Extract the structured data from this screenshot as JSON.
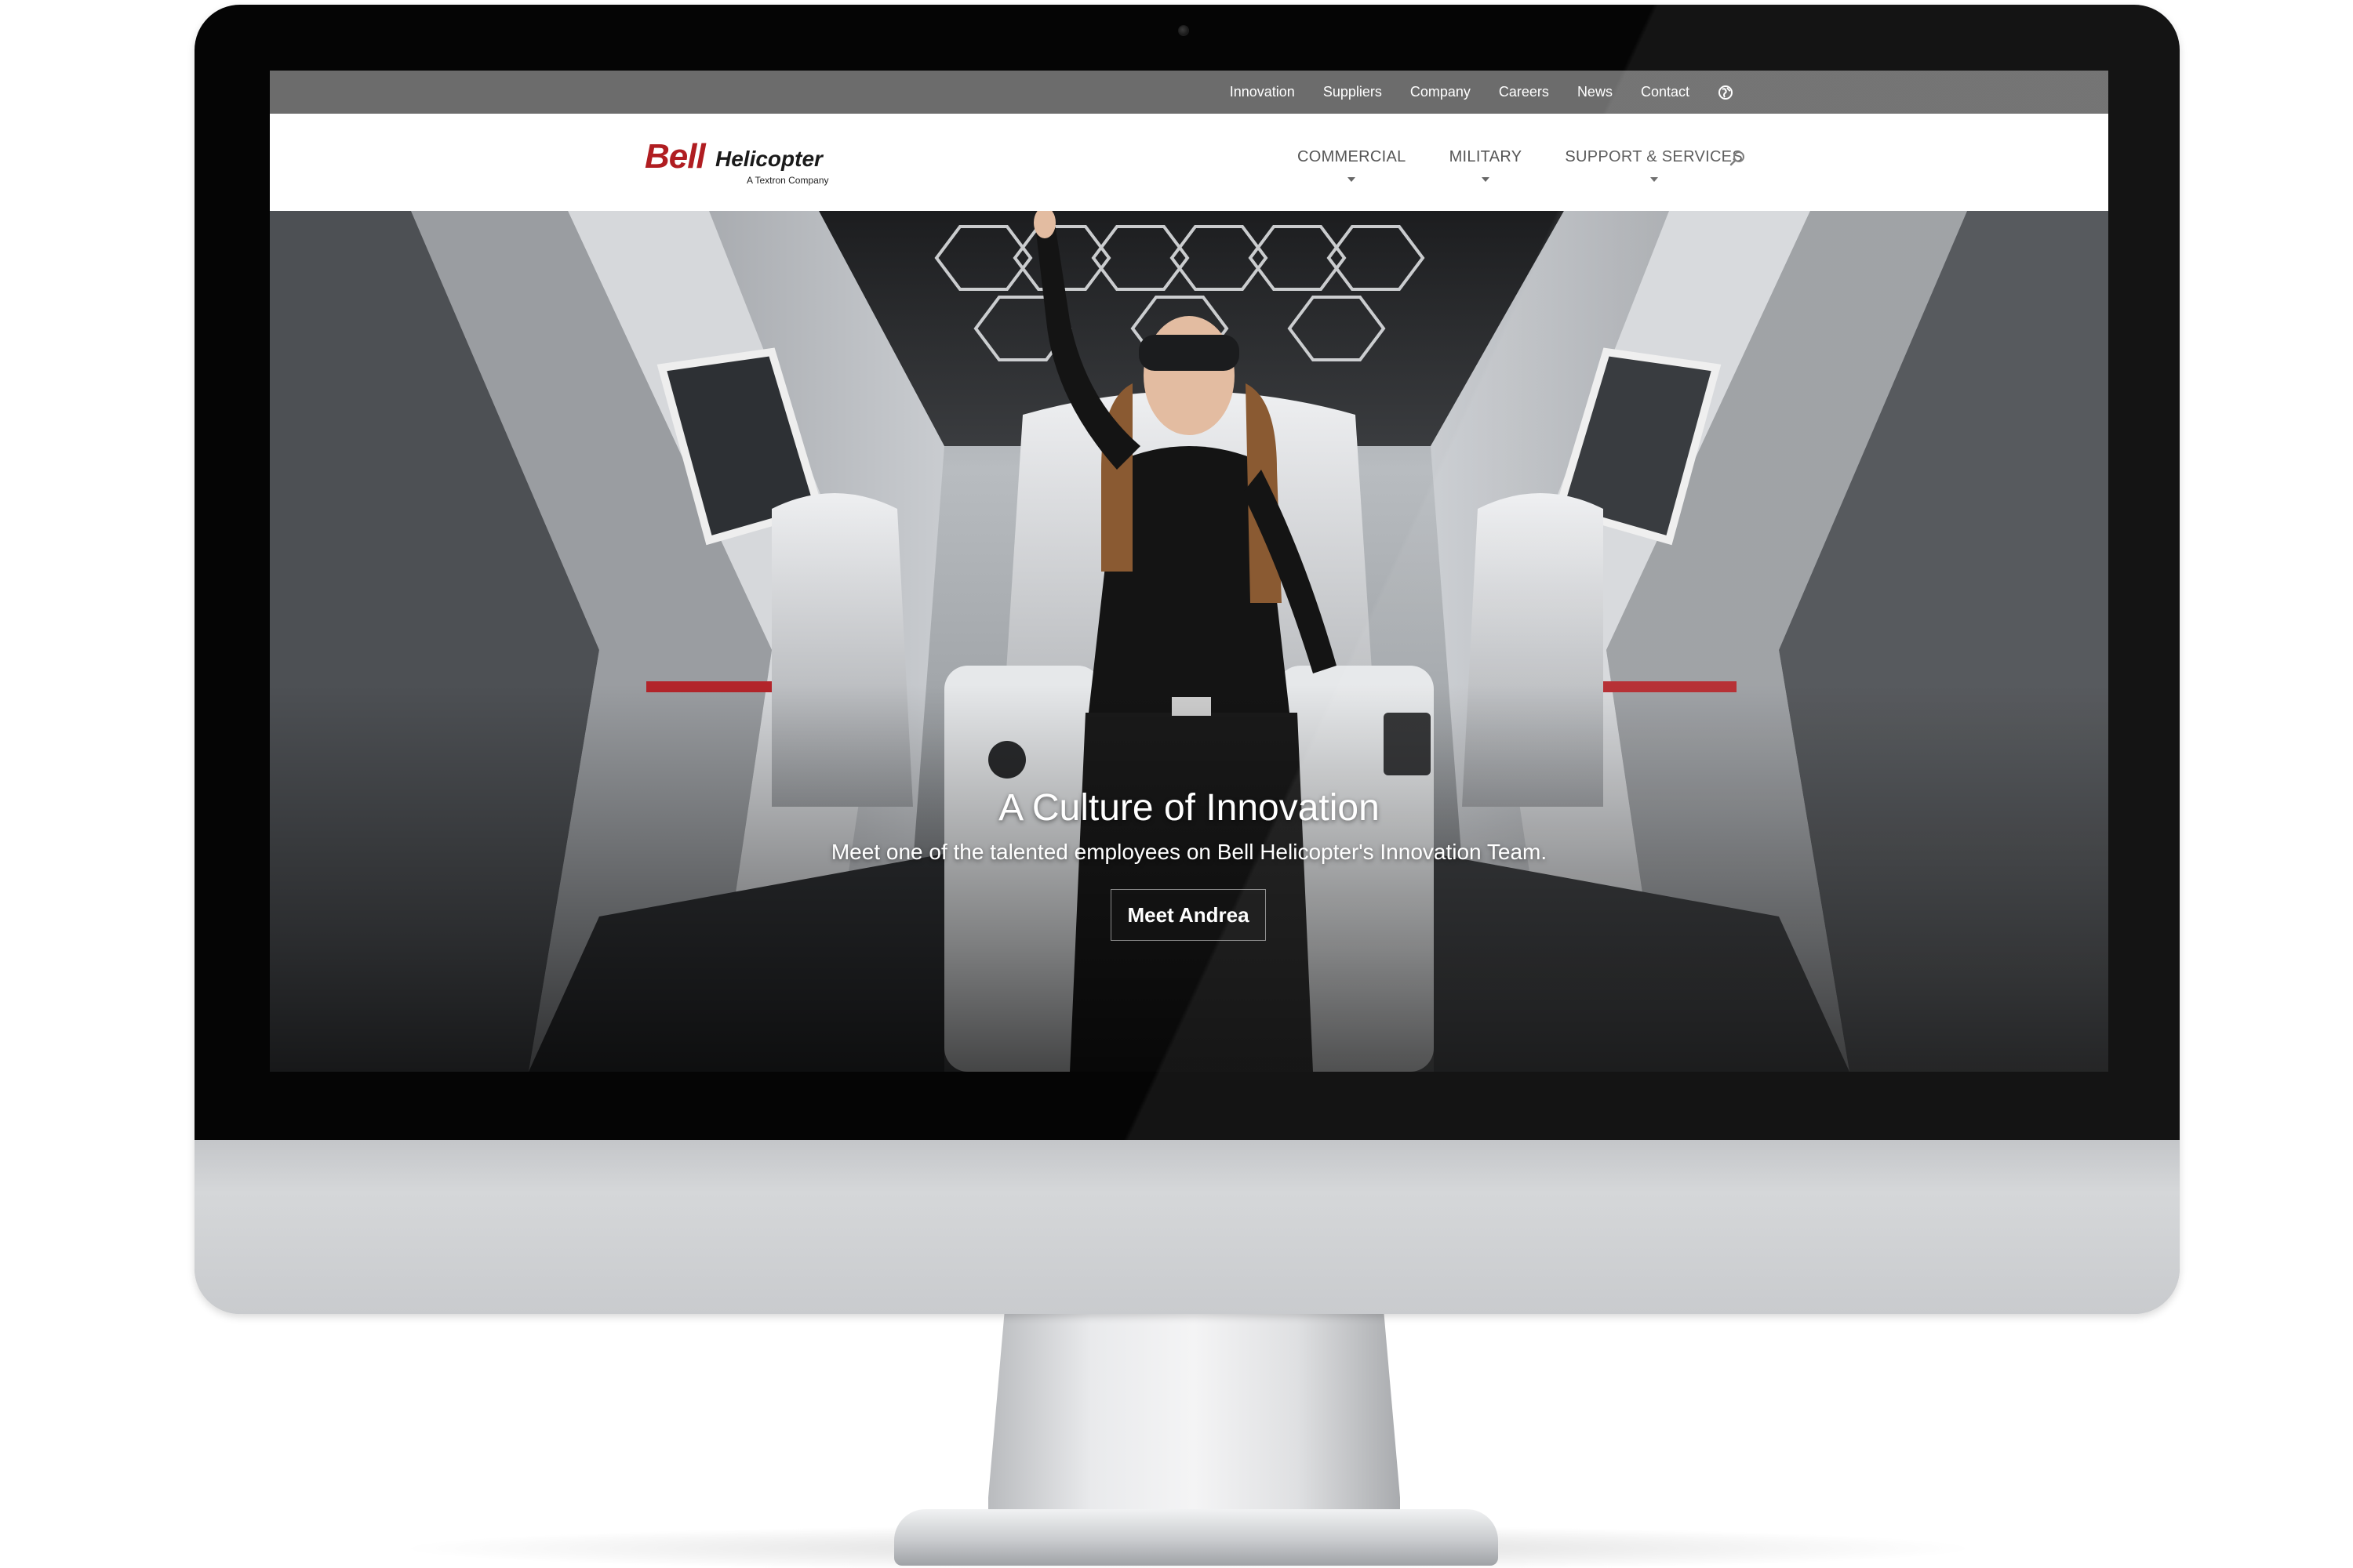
{
  "utility_nav": {
    "links": [
      "Innovation",
      "Suppliers",
      "Company",
      "Careers",
      "News",
      "Contact"
    ],
    "globe_icon": "globe-icon"
  },
  "brand": {
    "name": "Bell",
    "product": "Helicopter",
    "tagline": "A Textron Company",
    "color": "#b01d21"
  },
  "main_nav": {
    "items": [
      "COMMERCIAL",
      "MILITARY",
      "SUPPORT & SERVICES"
    ],
    "search_icon": "search-icon"
  },
  "hero": {
    "title": "A Culture of Innovation",
    "subtitle": "Meet one of the talented employees on Bell Helicopter's Innovation Team.",
    "button_label": "Meet Andrea"
  }
}
